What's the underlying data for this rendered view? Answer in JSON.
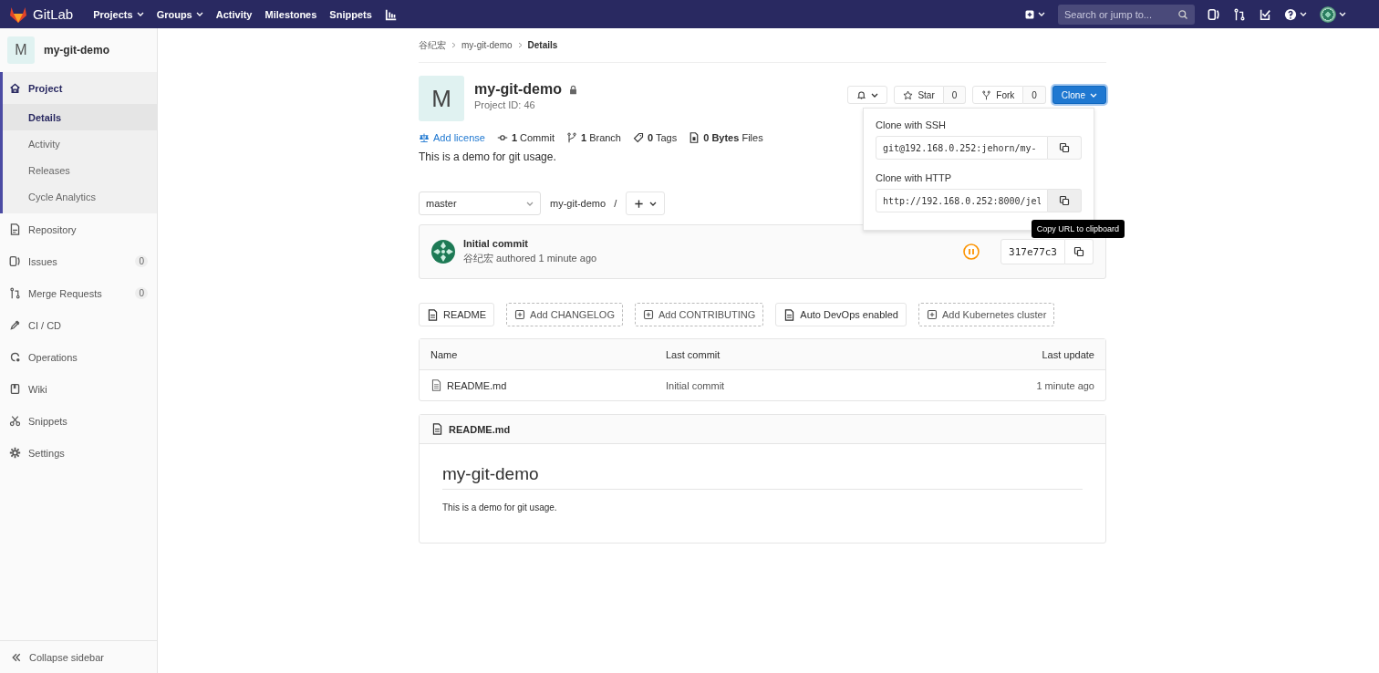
{
  "navbar": {
    "brand": "GitLab",
    "links": [
      {
        "label": "Projects",
        "dropdown": true
      },
      {
        "label": "Groups",
        "dropdown": true
      },
      {
        "label": "Activity",
        "dropdown": false
      },
      {
        "label": "Milestones",
        "dropdown": false
      },
      {
        "label": "Snippets",
        "dropdown": false
      }
    ],
    "search": {
      "placeholder": "Search or jump to..."
    }
  },
  "sidebar": {
    "project": {
      "avatar": "M",
      "name": "my-git-demo"
    },
    "items": [
      {
        "label": "Project",
        "selected": true,
        "children": [
          {
            "label": "Details",
            "selected": true
          },
          {
            "label": "Activity",
            "selected": false
          },
          {
            "label": "Releases",
            "selected": false
          },
          {
            "label": "Cycle Analytics",
            "selected": false
          }
        ]
      },
      {
        "label": "Repository",
        "selected": false
      },
      {
        "label": "Issues",
        "selected": false,
        "count": "0"
      },
      {
        "label": "Merge Requests",
        "selected": false,
        "count": "0"
      },
      {
        "label": "CI / CD",
        "selected": false
      },
      {
        "label": "Operations",
        "selected": false
      },
      {
        "label": "Wiki",
        "selected": false
      },
      {
        "label": "Snippets",
        "selected": false
      },
      {
        "label": "Settings",
        "selected": false
      }
    ],
    "collapse": "Collapse sidebar"
  },
  "breadcrumb": [
    "谷纪宏",
    "my-git-demo",
    "Details"
  ],
  "project": {
    "avatar": "M",
    "name": "my-git-demo",
    "private": true,
    "id": "Project ID: 46",
    "stats": [
      {
        "kind": "link",
        "text": "Add license"
      },
      {
        "kind": "stat",
        "text": "**1** Commit"
      },
      {
        "kind": "stat",
        "text": "**1** Branch"
      },
      {
        "kind": "stat",
        "text": "**0** Tags"
      },
      {
        "kind": "stat",
        "text": "**0 Bytes** Files"
      }
    ],
    "description": "This is a demo for git usage."
  },
  "actions": {
    "star": {
      "label": "Star",
      "count": "0"
    },
    "fork": {
      "label": "Fork",
      "count": "0"
    },
    "clone": "Clone"
  },
  "clone_dropdown": {
    "ssh_label": "Clone with SSH",
    "ssh_url": "git@192.168.0.252:jehorn/my-",
    "http_label": "Clone with HTTP",
    "http_url": "http://192.168.0.252:8000/jel",
    "tooltip": "Copy URL to clipboard"
  },
  "repo": {
    "branch": "master",
    "path": "my-git-demo",
    "separator": "/"
  },
  "last_commit": {
    "title": "Initial commit",
    "meta": "谷纪宏 authored 1 minute ago",
    "sha": "317e77c3"
  },
  "quick_buttons": [
    {
      "kind": "existing",
      "label": "README"
    },
    {
      "kind": "add",
      "label": "Add CHANGELOG"
    },
    {
      "kind": "add",
      "label": "Add CONTRIBUTING"
    },
    {
      "kind": "existing",
      "label": "Auto DevOps enabled"
    },
    {
      "kind": "add",
      "label": "Add Kubernetes cluster"
    }
  ],
  "table": {
    "columns": [
      "Name",
      "Last commit",
      "Last update"
    ],
    "rows": [
      {
        "name": "README.md",
        "commit": "Initial commit",
        "updated": "1 minute ago"
      }
    ]
  },
  "readme": {
    "file": "README.md",
    "heading": "my-git-demo",
    "text": "This is a demo for git usage."
  }
}
